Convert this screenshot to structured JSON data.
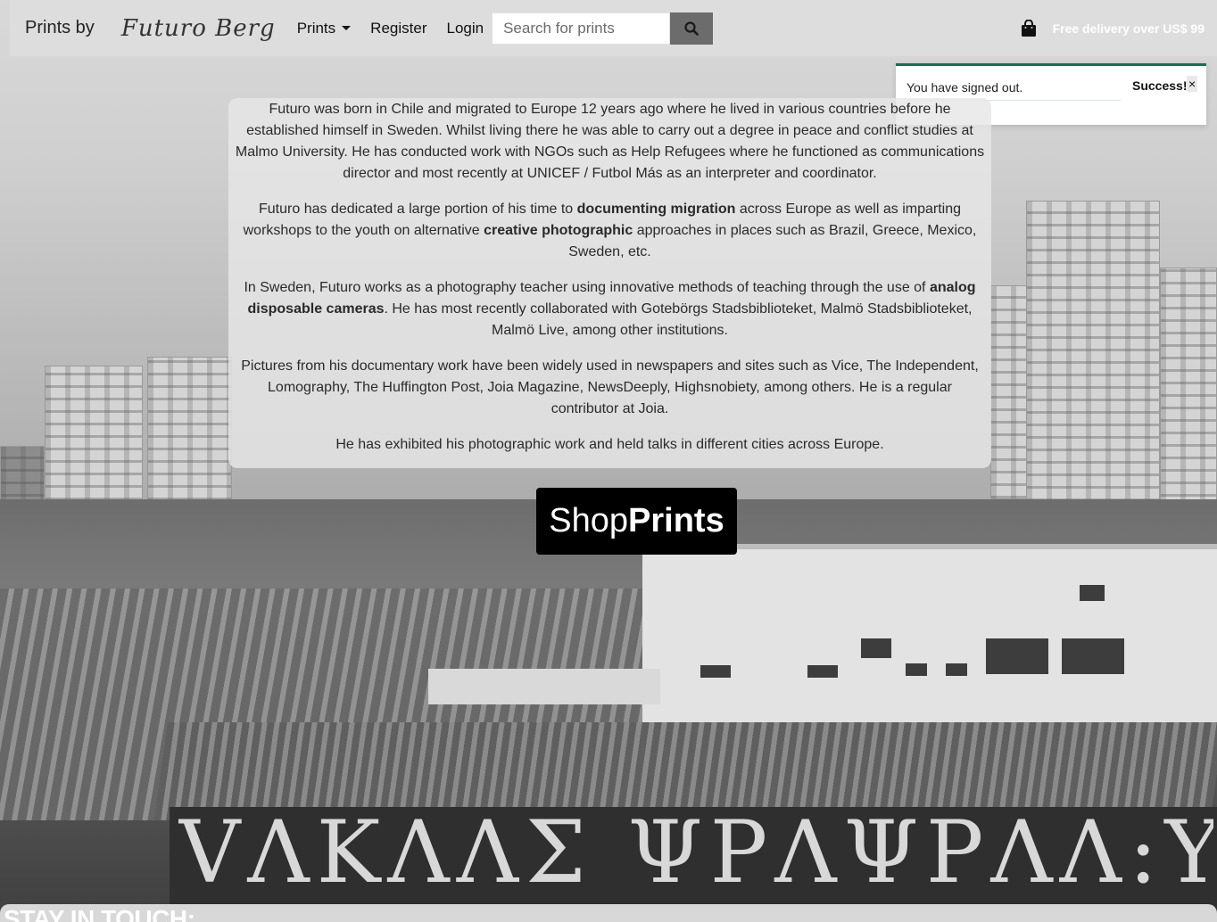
{
  "navbar": {
    "brand": "Prints by",
    "signature": "Futuro Berg",
    "prints_menu": "Prints",
    "register": "Register",
    "login": "Login",
    "search_placeholder": "Search for prints",
    "delivery_note": "Free delivery over US$ 99"
  },
  "toast": {
    "message": "You have signed out.",
    "title": "Success!",
    "close": "×"
  },
  "about": {
    "p1": "Futuro was born in Chile and migrated to Europe 12 years ago where he lived in various countries before he established himself in Sweden. Whilst living there he was able to carry out a degree in peace and conflict studies at Malmo University. He has conducted work with NGOs such as Help Refugees where he functioned as communications director and most recently at UNICEF / Futbol Más as an interpreter and coordinator.",
    "p2_a": "Futuro has dedicated a large portion of his time to ",
    "p2_b": "documenting migration",
    "p2_c": " across Europe as well as imparting workshops to the youth on alternative ",
    "p2_d": "creative photographic",
    "p2_e": " approaches in places such as Brazil, Greece, Mexico, Sweden, etc.",
    "p3_a": "In Sweden, Futuro works as a photography teacher using innovative methods of teaching through the use of ",
    "p3_b": "analog disposable cameras",
    "p3_c": ". He has most recently collaborated with Gotebörgs Stadsbiblioteket, Malmö Stadsbiblioteket, Malmö Live, among other institutions.",
    "p4": "Pictures from his documentary work have been widely used in newspapers and sites such as Vice, The Independent, Lomography, The Huffington Post, Joia Magazine, NewsDeeply, Highsnobiety, among others. He is a regular contributor at Joia.",
    "p5": "He has exhibited his photographic work and held talks in different cities across Europe."
  },
  "shop_button": {
    "light": "Shop",
    "bold": "Prints"
  },
  "footer": {
    "title": "STAY IN TOUCH:"
  },
  "background": {
    "graffiti": "VΛKΛΛΣ ΨΡΛΨΡΛΛ:ΥΙΚΦ"
  },
  "icons": {
    "search": "search-icon",
    "bag": "shopping-bag-icon",
    "caret": "chevron-down-icon"
  },
  "colors": {
    "navbar_bg": "#dddddd",
    "search_button": "#6c6c6c",
    "toast_accent": "#1e6b52",
    "shop_button_bg": "#000000"
  }
}
